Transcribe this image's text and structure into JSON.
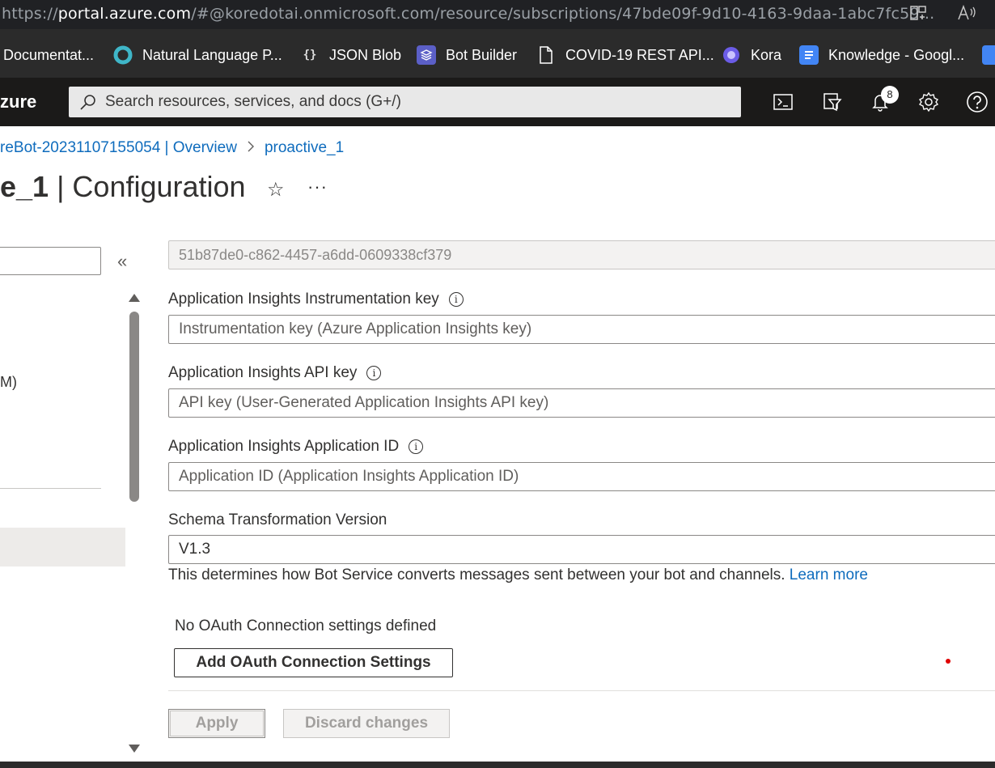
{
  "browser": {
    "url_prefix": "https://",
    "url_host": "portal.azure.com",
    "url_path": "/#@koredotai.onmicrosoft.com/resource/subscriptions/47bde09f-9d10-4163-9daa-1abc7fc59...",
    "icons": [
      "split-screen-icon",
      "read-aloud-icon"
    ]
  },
  "bookmarks": [
    {
      "label": "Documentat...",
      "icon": "none"
    },
    {
      "label": "Natural Language P...",
      "icon": "ring-icon"
    },
    {
      "label": "JSON Blob",
      "icon": "braces-icon"
    },
    {
      "label": "Bot Builder",
      "icon": "layers-icon"
    },
    {
      "label": "COVID-19 REST API...",
      "icon": "document-icon"
    },
    {
      "label": "Kora",
      "icon": "circle-icon"
    },
    {
      "label": "Knowledge - Googl...",
      "icon": "docs-icon"
    }
  ],
  "topnav": {
    "brand": "zure",
    "search_placeholder": "Search resources, services, and docs (G+/)",
    "notification_count": "8"
  },
  "breadcrumb": {
    "parent": "reBot-20231107155054 | Overview",
    "current": "proactive_1"
  },
  "page": {
    "title_part1": "e_1",
    "title_part2": " | Configuration",
    "favorite_icon": "☆",
    "more_icon": "···"
  },
  "left_panel": {
    "collapse_icon": "«",
    "partial_text": "M)"
  },
  "form": {
    "app_id_value": "51b87de0-c862-4457-a6dd-0609338cf379",
    "instrumentation_key_label": "Application Insights Instrumentation key",
    "instrumentation_key_placeholder": "Instrumentation key (Azure Application Insights key)",
    "api_key_label": "Application Insights API key",
    "api_key_placeholder": "API key (User-Generated Application Insights API key)",
    "application_id_label": "Application Insights Application ID",
    "application_id_placeholder": "Application ID (Application Insights Application ID)",
    "schema_label": "Schema Transformation Version",
    "schema_value": "V1.3",
    "schema_help": "This determines how Bot Service converts messages sent between your bot and channels. ",
    "learn_more": "Learn more",
    "oauth_none": "No OAuth Connection settings defined",
    "oauth_button": "Add OAuth Connection Settings",
    "apply": "Apply",
    "discard": "Discard changes",
    "info_glyph": "i"
  },
  "colors": {
    "link": "#0f6cbd",
    "topnav_bg": "#1b1a19",
    "accent_dot": "#e00000"
  }
}
